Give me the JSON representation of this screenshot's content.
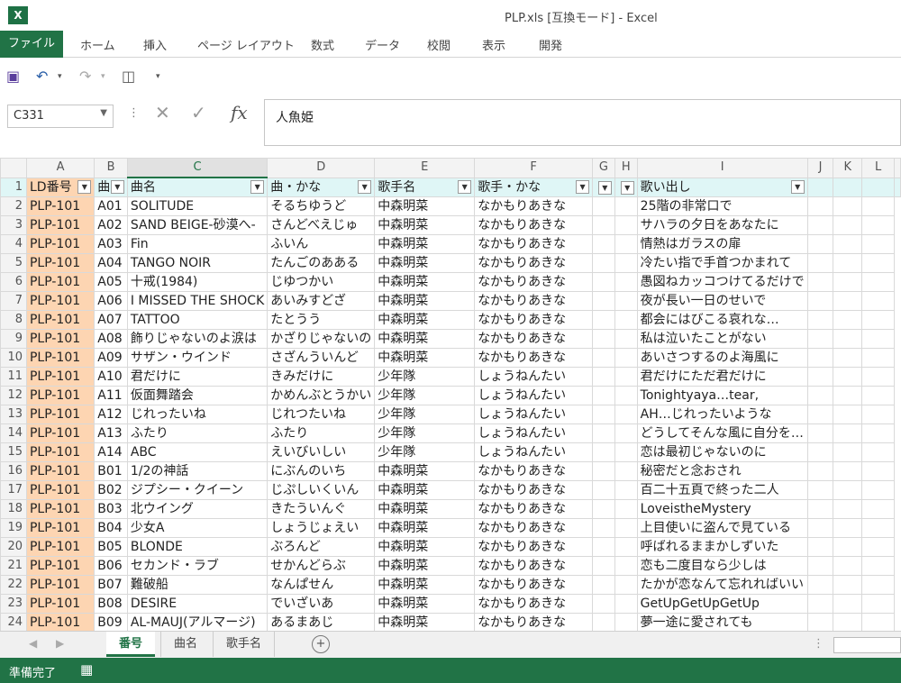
{
  "window": {
    "title": "PLP.xls  [互換モード] - Excel",
    "app_icon": "X"
  },
  "ribbon": {
    "tabs": [
      "ファイル",
      "ホーム",
      "挿入",
      "ページ レイアウト",
      "数式",
      "データ",
      "校閲",
      "表示",
      "開発"
    ]
  },
  "formula_bar": {
    "name_box": "C331",
    "formula": "人魚姫"
  },
  "columns": [
    "A",
    "B",
    "C",
    "D",
    "E",
    "F",
    "G",
    "H",
    "I",
    "J",
    "K",
    "L"
  ],
  "header_row": {
    "row": "1",
    "cells": [
      "LD番号",
      "曲",
      "曲名",
      "曲・かな",
      "歌手名",
      "歌手・かな",
      "",
      "",
      "歌い出し",
      "",
      "",
      ""
    ]
  },
  "rows": [
    [
      "2",
      "PLP-101",
      "A01",
      "SOLITUDE",
      "そるちゆうど",
      "中森明菜",
      "なかもりあきな",
      "",
      "",
      "25階の非常口で",
      "",
      "",
      ""
    ],
    [
      "3",
      "PLP-101",
      "A02",
      "SAND BEIGE-砂漠へ-",
      "さんどべえじゅ",
      "中森明菜",
      "なかもりあきな",
      "",
      "",
      "サハラの夕日をあなたに",
      "",
      "",
      ""
    ],
    [
      "4",
      "PLP-101",
      "A03",
      "Fin",
      "ふいん",
      "中森明菜",
      "なかもりあきな",
      "",
      "",
      "情熱はガラスの扉",
      "",
      "",
      ""
    ],
    [
      "5",
      "PLP-101",
      "A04",
      "TANGO NOIR",
      "たんごのあある",
      "中森明菜",
      "なかもりあきな",
      "",
      "",
      "冷たい指で手首つかまれて",
      "",
      "",
      ""
    ],
    [
      "6",
      "PLP-101",
      "A05",
      "十戒(1984)",
      "じゆつかい",
      "中森明菜",
      "なかもりあきな",
      "",
      "",
      "愚図ねカッコつけてるだけで",
      "",
      "",
      ""
    ],
    [
      "7",
      "PLP-101",
      "A06",
      "I MISSED THE SHOCK",
      "あいみすどざ",
      "中森明菜",
      "なかもりあきな",
      "",
      "",
      "夜が長い一日のせいで",
      "",
      "",
      ""
    ],
    [
      "8",
      "PLP-101",
      "A07",
      "TATTOO",
      "たとうう",
      "中森明菜",
      "なかもりあきな",
      "",
      "",
      "都会にはびこる哀れな…",
      "",
      "",
      ""
    ],
    [
      "9",
      "PLP-101",
      "A08",
      "飾りじゃないのよ涙は",
      "かざりじゃないの",
      "中森明菜",
      "なかもりあきな",
      "",
      "",
      "私は泣いたことがない",
      "",
      "",
      ""
    ],
    [
      "10",
      "PLP-101",
      "A09",
      "サザン・ウインド",
      "さざんういんど",
      "中森明菜",
      "なかもりあきな",
      "",
      "",
      "あいさつするのよ海風に",
      "",
      "",
      ""
    ],
    [
      "11",
      "PLP-101",
      "A10",
      "君だけに",
      "きみだけに",
      "少年隊",
      "しょうねんたい",
      "",
      "",
      "君だけにただ君だけに",
      "",
      "",
      ""
    ],
    [
      "12",
      "PLP-101",
      "A11",
      "仮面舞踏会",
      "かめんぶとうかい",
      "少年隊",
      "しょうねんたい",
      "",
      "",
      "Tonightyaya…tear,",
      "",
      "",
      ""
    ],
    [
      "13",
      "PLP-101",
      "A12",
      "じれったいね",
      "じれつたいね",
      "少年隊",
      "しょうねんたい",
      "",
      "",
      "AH…じれったいような",
      "",
      "",
      ""
    ],
    [
      "14",
      "PLP-101",
      "A13",
      "ふたり",
      "ふたり",
      "少年隊",
      "しょうねんたい",
      "",
      "",
      "どうしてそんな風に自分を…",
      "",
      "",
      ""
    ],
    [
      "15",
      "PLP-101",
      "A14",
      "ABC",
      "えいびいしい",
      "少年隊",
      "しょうねんたい",
      "",
      "",
      "恋は最初じゃないのに",
      "",
      "",
      ""
    ],
    [
      "16",
      "PLP-101",
      "B01",
      "1/2の神話",
      "にぶんのいち",
      "中森明菜",
      "なかもりあきな",
      "",
      "",
      "秘密だと念おされ",
      "",
      "",
      ""
    ],
    [
      "17",
      "PLP-101",
      "B02",
      "ジプシー・クイーン",
      "じぷしいくいん",
      "中森明菜",
      "なかもりあきな",
      "",
      "",
      "百二十五頁で終った二人",
      "",
      "",
      ""
    ],
    [
      "18",
      "PLP-101",
      "B03",
      "北ウイング",
      "きたういんぐ",
      "中森明菜",
      "なかもりあきな",
      "",
      "",
      "LoveistheMystery",
      "",
      "",
      ""
    ],
    [
      "19",
      "PLP-101",
      "B04",
      "少女A",
      "しょうじょえい",
      "中森明菜",
      "なかもりあきな",
      "",
      "",
      "上目使いに盗んで見ている",
      "",
      "",
      ""
    ],
    [
      "20",
      "PLP-101",
      "B05",
      "BLONDE",
      "ぶろんど",
      "中森明菜",
      "なかもりあきな",
      "",
      "",
      "呼ばれるままかしずいた",
      "",
      "",
      ""
    ],
    [
      "21",
      "PLP-101",
      "B06",
      "セカンド・ラブ",
      "せかんどらぶ",
      "中森明菜",
      "なかもりあきな",
      "",
      "",
      "恋も二度目なら少しは",
      "",
      "",
      ""
    ],
    [
      "22",
      "PLP-101",
      "B07",
      "難破船",
      "なんぱせん",
      "中森明菜",
      "なかもりあきな",
      "",
      "",
      "たかが恋なんて忘れればいい",
      "",
      "",
      ""
    ],
    [
      "23",
      "PLP-101",
      "B08",
      "DESIRE",
      "でいざいあ",
      "中森明菜",
      "なかもりあきな",
      "",
      "",
      "GetUpGetUpGetUp",
      "",
      "",
      ""
    ],
    [
      "24",
      "PLP-101",
      "B09",
      "AL-MAUJ(アルマージ)",
      "あるまあじ",
      "中森明菜",
      "なかもりあきな",
      "",
      "",
      "夢一途に愛されても",
      "",
      "",
      ""
    ]
  ],
  "sheets": [
    "番号",
    "曲名",
    "歌手名"
  ],
  "active_sheet": "番号",
  "status": {
    "text": "準備完了"
  },
  "colors": {
    "excel_green": "#217346",
    "column_a_fill": "#fdd5b2",
    "header_fill": "#dff6f6"
  }
}
